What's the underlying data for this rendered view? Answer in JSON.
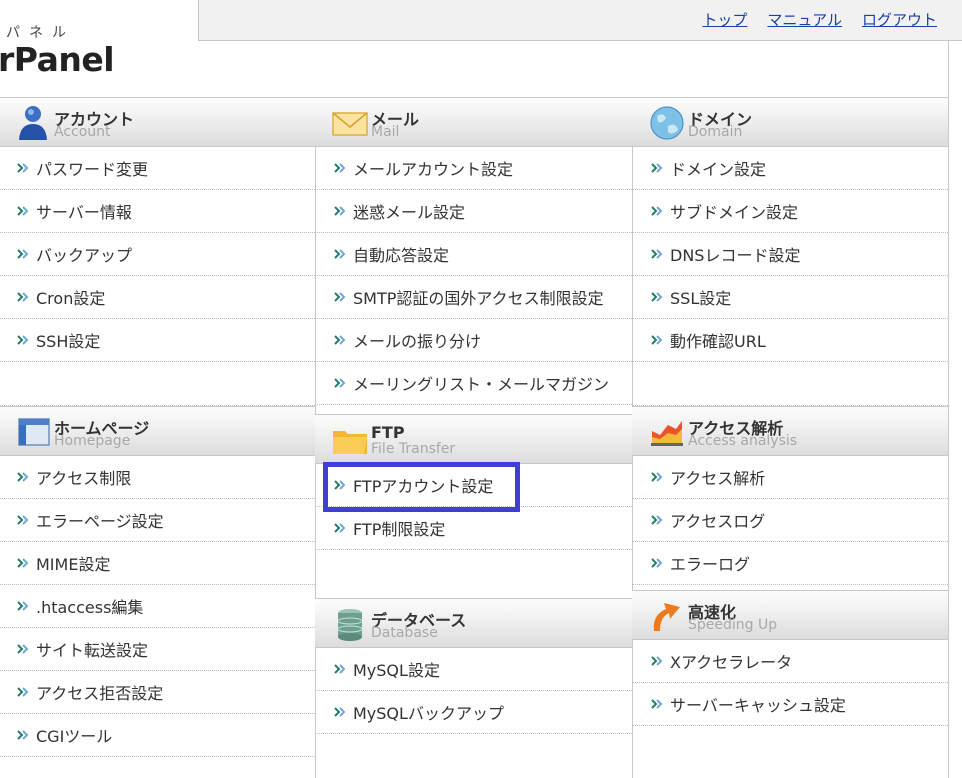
{
  "brand": {
    "sub": "パネル",
    "name": "rPanel"
  },
  "top_links": [
    "トップ",
    "マニュアル",
    "ログアウト"
  ],
  "sections": {
    "account": {
      "title": "アカウント",
      "subtitle": "Account",
      "items": [
        "パスワード変更",
        "サーバー情報",
        "バックアップ",
        "Cron設定",
        "SSH設定"
      ]
    },
    "homepage": {
      "title": "ホームページ",
      "subtitle": "Homepage",
      "items": [
        "アクセス制限",
        "エラーページ設定",
        "MIME設定",
        ".htaccess編集",
        "サイト転送設定",
        "アクセス拒否設定",
        "CGIツール"
      ]
    },
    "mail": {
      "title": "メール",
      "subtitle": "Mail",
      "items": [
        "メールアカウント設定",
        "迷惑メール設定",
        "自動応答設定",
        "SMTP認証の国外アクセス制限設定",
        "メールの振り分け",
        "メーリングリスト・メールマガジン"
      ]
    },
    "ftp": {
      "title": "FTP",
      "subtitle": "File Transfer",
      "items": [
        "FTPアカウント設定",
        "FTP制限設定"
      ]
    },
    "database": {
      "title": "データベース",
      "subtitle": "Database",
      "items": [
        "MySQL設定",
        "MySQLバックアップ"
      ]
    },
    "domain": {
      "title": "ドメイン",
      "subtitle": "Domain",
      "items": [
        "ドメイン設定",
        "サブドメイン設定",
        "DNSレコード設定",
        "SSL設定",
        "動作確認URL"
      ]
    },
    "access": {
      "title": "アクセス解析",
      "subtitle": "Access analysis",
      "items": [
        "アクセス解析",
        "アクセスログ",
        "エラーログ"
      ]
    },
    "speed": {
      "title": "高速化",
      "subtitle": "Speeding Up",
      "items": [
        "Xアクセラレータ",
        "サーバーキャッシュ設定"
      ]
    }
  },
  "icons": {
    "account": "user-icon",
    "mail": "envelope-icon",
    "domain": "globe-icon",
    "homepage": "window-icon",
    "ftp": "folder-icon",
    "access": "chart-icon",
    "database": "database-icon",
    "speed": "speed-arrow-icon",
    "item_arrow": "arrow-bullet-icon"
  },
  "colors": {
    "link": "#1b3fa8",
    "highlight": "#3f3fd1"
  }
}
